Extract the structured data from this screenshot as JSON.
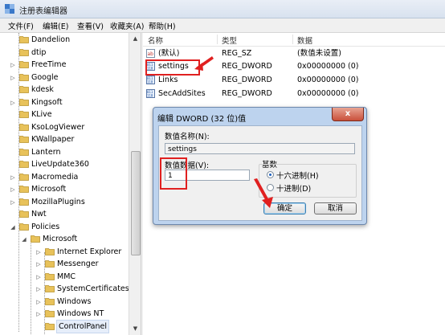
{
  "window": {
    "title": "注册表编辑器"
  },
  "menu": [
    {
      "label": "文件(F)"
    },
    {
      "label": "编辑(E)"
    },
    {
      "label": "查看(V)"
    },
    {
      "label": "收藏夹(A)"
    },
    {
      "label": "帮助(H)"
    }
  ],
  "tree": {
    "items": [
      {
        "label": "Dandelion",
        "level": 1,
        "expander": ""
      },
      {
        "label": "dtip",
        "level": 1,
        "expander": ""
      },
      {
        "label": "FreeTime",
        "level": 1,
        "expander": "▷"
      },
      {
        "label": "Google",
        "level": 1,
        "expander": "▷"
      },
      {
        "label": "kdesk",
        "level": 1,
        "expander": ""
      },
      {
        "label": "Kingsoft",
        "level": 1,
        "expander": "▷"
      },
      {
        "label": "KLive",
        "level": 1,
        "expander": ""
      },
      {
        "label": "KsoLogViewer",
        "level": 1,
        "expander": ""
      },
      {
        "label": "KWallpaper",
        "level": 1,
        "expander": ""
      },
      {
        "label": "Lantern",
        "level": 1,
        "expander": ""
      },
      {
        "label": "LiveUpdate360",
        "level": 1,
        "expander": ""
      },
      {
        "label": "Macromedia",
        "level": 1,
        "expander": "▷"
      },
      {
        "label": "Microsoft",
        "level": 1,
        "expander": "▷"
      },
      {
        "label": "MozillaPlugins",
        "level": 1,
        "expander": "▷"
      },
      {
        "label": "Nwt",
        "level": 1,
        "expander": ""
      },
      {
        "label": "Policies",
        "level": 1,
        "expander": "◢"
      },
      {
        "label": "Microsoft",
        "level": 2,
        "expander": "◢"
      },
      {
        "label": "Internet Explorer",
        "level": 3,
        "expander": "▷"
      },
      {
        "label": "Messenger",
        "level": 3,
        "expander": "▷"
      },
      {
        "label": "MMC",
        "level": 3,
        "expander": "▷"
      },
      {
        "label": "SystemCertificates",
        "level": 3,
        "expander": "▷"
      },
      {
        "label": "Windows",
        "level": 3,
        "expander": "▷"
      },
      {
        "label": "Windows NT",
        "level": 3,
        "expander": "▷"
      },
      {
        "label": "ControlPanel",
        "level": 3,
        "expander": "",
        "selected": true
      }
    ]
  },
  "list": {
    "columns": [
      "名称",
      "类型",
      "数据"
    ],
    "rows": [
      {
        "name": "(默认)",
        "type": "REG_SZ",
        "data": "(数值未设置)",
        "icon": "string-value-icon"
      },
      {
        "name": "settings",
        "type": "REG_DWORD",
        "data": "0x00000000 (0)",
        "icon": "dword-value-icon"
      },
      {
        "name": "Links",
        "type": "REG_DWORD",
        "data": "0x00000000 (0)",
        "icon": "dword-value-icon"
      },
      {
        "name": "SecAddSites",
        "type": "REG_DWORD",
        "data": "0x00000000 (0)",
        "icon": "dword-value-icon"
      }
    ]
  },
  "dialog": {
    "title": "编辑 DWORD (32 位)值",
    "close": "x",
    "value_name_label": "数值名称(N):",
    "value_name": "settings",
    "value_data_label": "数值数据(V):",
    "value_data": "1",
    "base_label": "基数",
    "hex_label": "十六进制(H)",
    "dec_label": "十进制(D)",
    "ok": "确定",
    "cancel": "取消"
  },
  "colors": {
    "annotation": "#e02020",
    "folder": "#e8c25a"
  }
}
